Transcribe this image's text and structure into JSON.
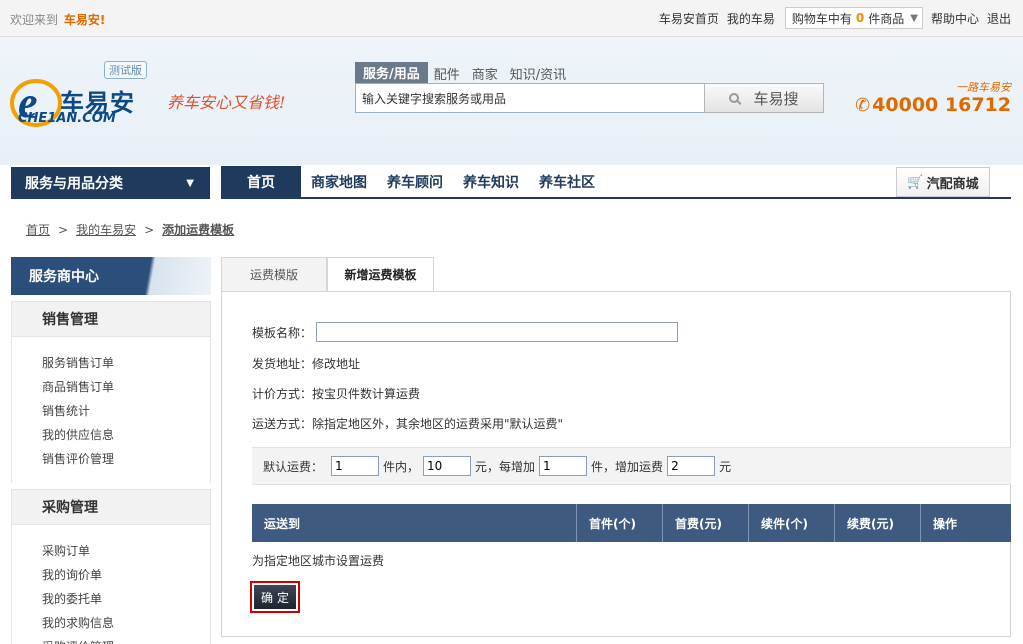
{
  "topbar": {
    "welcome": "欢迎来到",
    "brand": "车易安",
    "bang": "!",
    "links": [
      "车易安首页",
      "我的车易"
    ],
    "cart_prefix": "购物车中有",
    "cart_count": "0",
    "cart_suffix": "件商品",
    "help": "帮助中心",
    "logout": "退出"
  },
  "header": {
    "logo_badge": "测试版",
    "logo_cn": "车易安",
    "logo_en": "CHE1AN.COM",
    "slogan": "养车安心又省钱!",
    "search_tabs": [
      "服务/用品",
      "配件",
      "商家",
      "知识/资讯"
    ],
    "search_placeholder": "输入关键字搜索服务或用品",
    "search_button": "车易搜",
    "hotline_tag": "一路车易安",
    "hotline": "40000 16712"
  },
  "nav": {
    "category": "服务与用品分类",
    "items": [
      "首页",
      "商家地图",
      "养车顾问",
      "养车知识",
      "养车社区"
    ],
    "mall": "汽配商城"
  },
  "breadcrumb": {
    "items": [
      "首页",
      "我的车易安",
      "添加运费模板"
    ],
    "sep": ">"
  },
  "sidebar": {
    "title": "服务商中心",
    "groups": [
      {
        "title": "销售管理",
        "items": [
          "服务销售订单",
          "商品销售订单",
          "销售统计",
          "我的供应信息",
          "销售评价管理"
        ]
      },
      {
        "title": "采购管理",
        "items": [
          "采购订单",
          "我的询价单",
          "我的委托单",
          "我的求购信息",
          "采购评价管理"
        ]
      }
    ]
  },
  "tabs": [
    "运费模版",
    "新增运费模板"
  ],
  "form": {
    "name_label": "模板名称：",
    "name_value": "",
    "ship_from_label": "发货地址：",
    "ship_from_link": "修改地址",
    "pricing_label": "计价方式：",
    "pricing_value": "按宝贝件数计算运费",
    "delivery_label": "运送方式：",
    "delivery_value": "除指定地区外，其余地区的运费采用\"默认运费\"",
    "default_fee": {
      "label": "默认运费：",
      "first_qty": "1",
      "unit1": "件内，",
      "first_fee": "10",
      "unit2": "元，每增加",
      "add_qty": "1",
      "unit3": "件，增加运费",
      "add_fee": "2",
      "unit4": "元"
    },
    "table_headers": [
      "运送到",
      "首件(个)",
      "首费(元)",
      "续件(个)",
      "续费(元)",
      "操作"
    ],
    "set_city": "为指定地区城市设置运费",
    "confirm": "确定"
  },
  "colors": {
    "nav_dark": "#1f3a5c",
    "table_header": "#3e5a80",
    "accent_orange": "#e06a00",
    "confirm_border": "#d00000"
  }
}
